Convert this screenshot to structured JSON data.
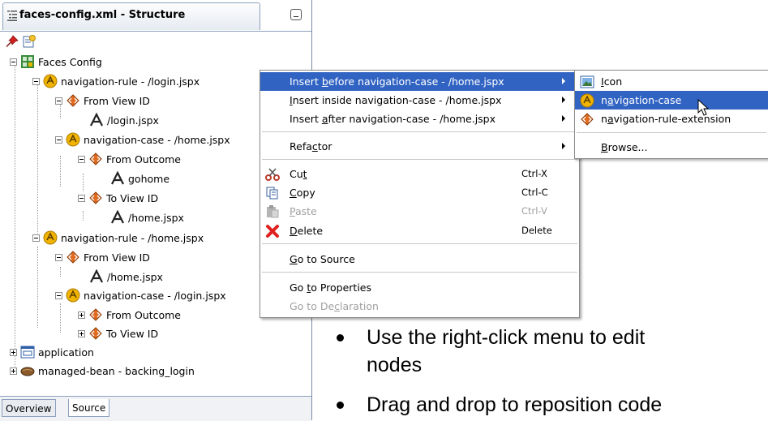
{
  "panel": {
    "title": "faces-config.xml - Structure",
    "tree": [
      {
        "label": "Faces Config",
        "icon": "faces-config-icon"
      },
      {
        "label": "navigation-rule - /login.jspx",
        "icon": "navigation-icon"
      },
      {
        "label": "From View ID",
        "icon": "element-icon"
      },
      {
        "label": "/login.jspx",
        "icon": "text-node-icon"
      },
      {
        "label": "navigation-case - /home.jspx",
        "icon": "navigation-icon"
      },
      {
        "label": "From Outcome",
        "icon": "element-icon"
      },
      {
        "label": "gohome",
        "icon": "text-node-icon"
      },
      {
        "label": "To View ID",
        "icon": "element-icon"
      },
      {
        "label": "/home.jspx",
        "icon": "text-node-icon"
      },
      {
        "label": "navigation-rule - /home.jspx",
        "icon": "navigation-icon"
      },
      {
        "label": "From View ID",
        "icon": "element-icon"
      },
      {
        "label": "/home.jspx",
        "icon": "text-node-icon"
      },
      {
        "label": "navigation-case - /login.jspx",
        "icon": "navigation-icon"
      },
      {
        "label": "From Outcome",
        "icon": "element-icon"
      },
      {
        "label": "To View ID",
        "icon": "element-icon"
      },
      {
        "label": "application",
        "icon": "application-icon"
      },
      {
        "label": "managed-bean - backing_login",
        "icon": "bean-icon"
      }
    ],
    "bottom_tabs": [
      "Overview",
      "Source"
    ]
  },
  "context_menu": {
    "items": [
      {
        "pre": "Insert ",
        "key": "b",
        "post": "efore navigation-case - /home.jspx",
        "accel": "",
        "submenu": true,
        "highlighted": true
      },
      {
        "pre": "",
        "key": "I",
        "post": "nsert inside navigation-case - /home.jspx",
        "accel": "",
        "submenu": true
      },
      {
        "pre": "Insert ",
        "key": "a",
        "post": "fter navigation-case - /home.jspx",
        "accel": "",
        "submenu": true
      },
      {
        "pre": "Refa",
        "key": "c",
        "post": "tor",
        "accel": "",
        "submenu": true
      },
      {
        "pre": "Cu",
        "key": "t",
        "post": "",
        "accel": "Ctrl-X",
        "icon": "scissors-icon"
      },
      {
        "pre": "",
        "key": "C",
        "post": "opy",
        "accel": "Ctrl-C",
        "icon": "copy-icon"
      },
      {
        "pre": "",
        "key": "P",
        "post": "aste",
        "accel": "Ctrl-V",
        "icon": "paste-icon",
        "disabled": true
      },
      {
        "pre": "",
        "key": "D",
        "post": "elete",
        "accel": "Delete",
        "icon": "delete-icon"
      },
      {
        "pre": "",
        "key": "G",
        "post": "o to Source",
        "accel": ""
      },
      {
        "pre": "Go ",
        "key": "t",
        "post": "o Properties",
        "accel": ""
      },
      {
        "pre": "Go to De",
        "key": "c",
        "post": "laration",
        "accel": "",
        "disabled": true
      }
    ]
  },
  "submenu": {
    "items": [
      {
        "pre": "",
        "key": "I",
        "post": "con",
        "icon": "image-icon"
      },
      {
        "pre": "n",
        "key": "a",
        "post": "vigation-case",
        "icon": "navigation-icon",
        "highlighted": true
      },
      {
        "pre": "n",
        "key": "a",
        "post": "vigation-rule-extension",
        "icon": "element-icon"
      },
      {
        "pre": "",
        "key": "B",
        "post": "rowse...",
        "icon": ""
      }
    ]
  },
  "bullets": [
    "Use the right-click menu to edit",
    "nodes",
    "Drag and drop to reposition code"
  ],
  "colors": {
    "highlight": "#3163c3",
    "nav_icon": "#f0b400",
    "element_icon": "#e06a20"
  }
}
